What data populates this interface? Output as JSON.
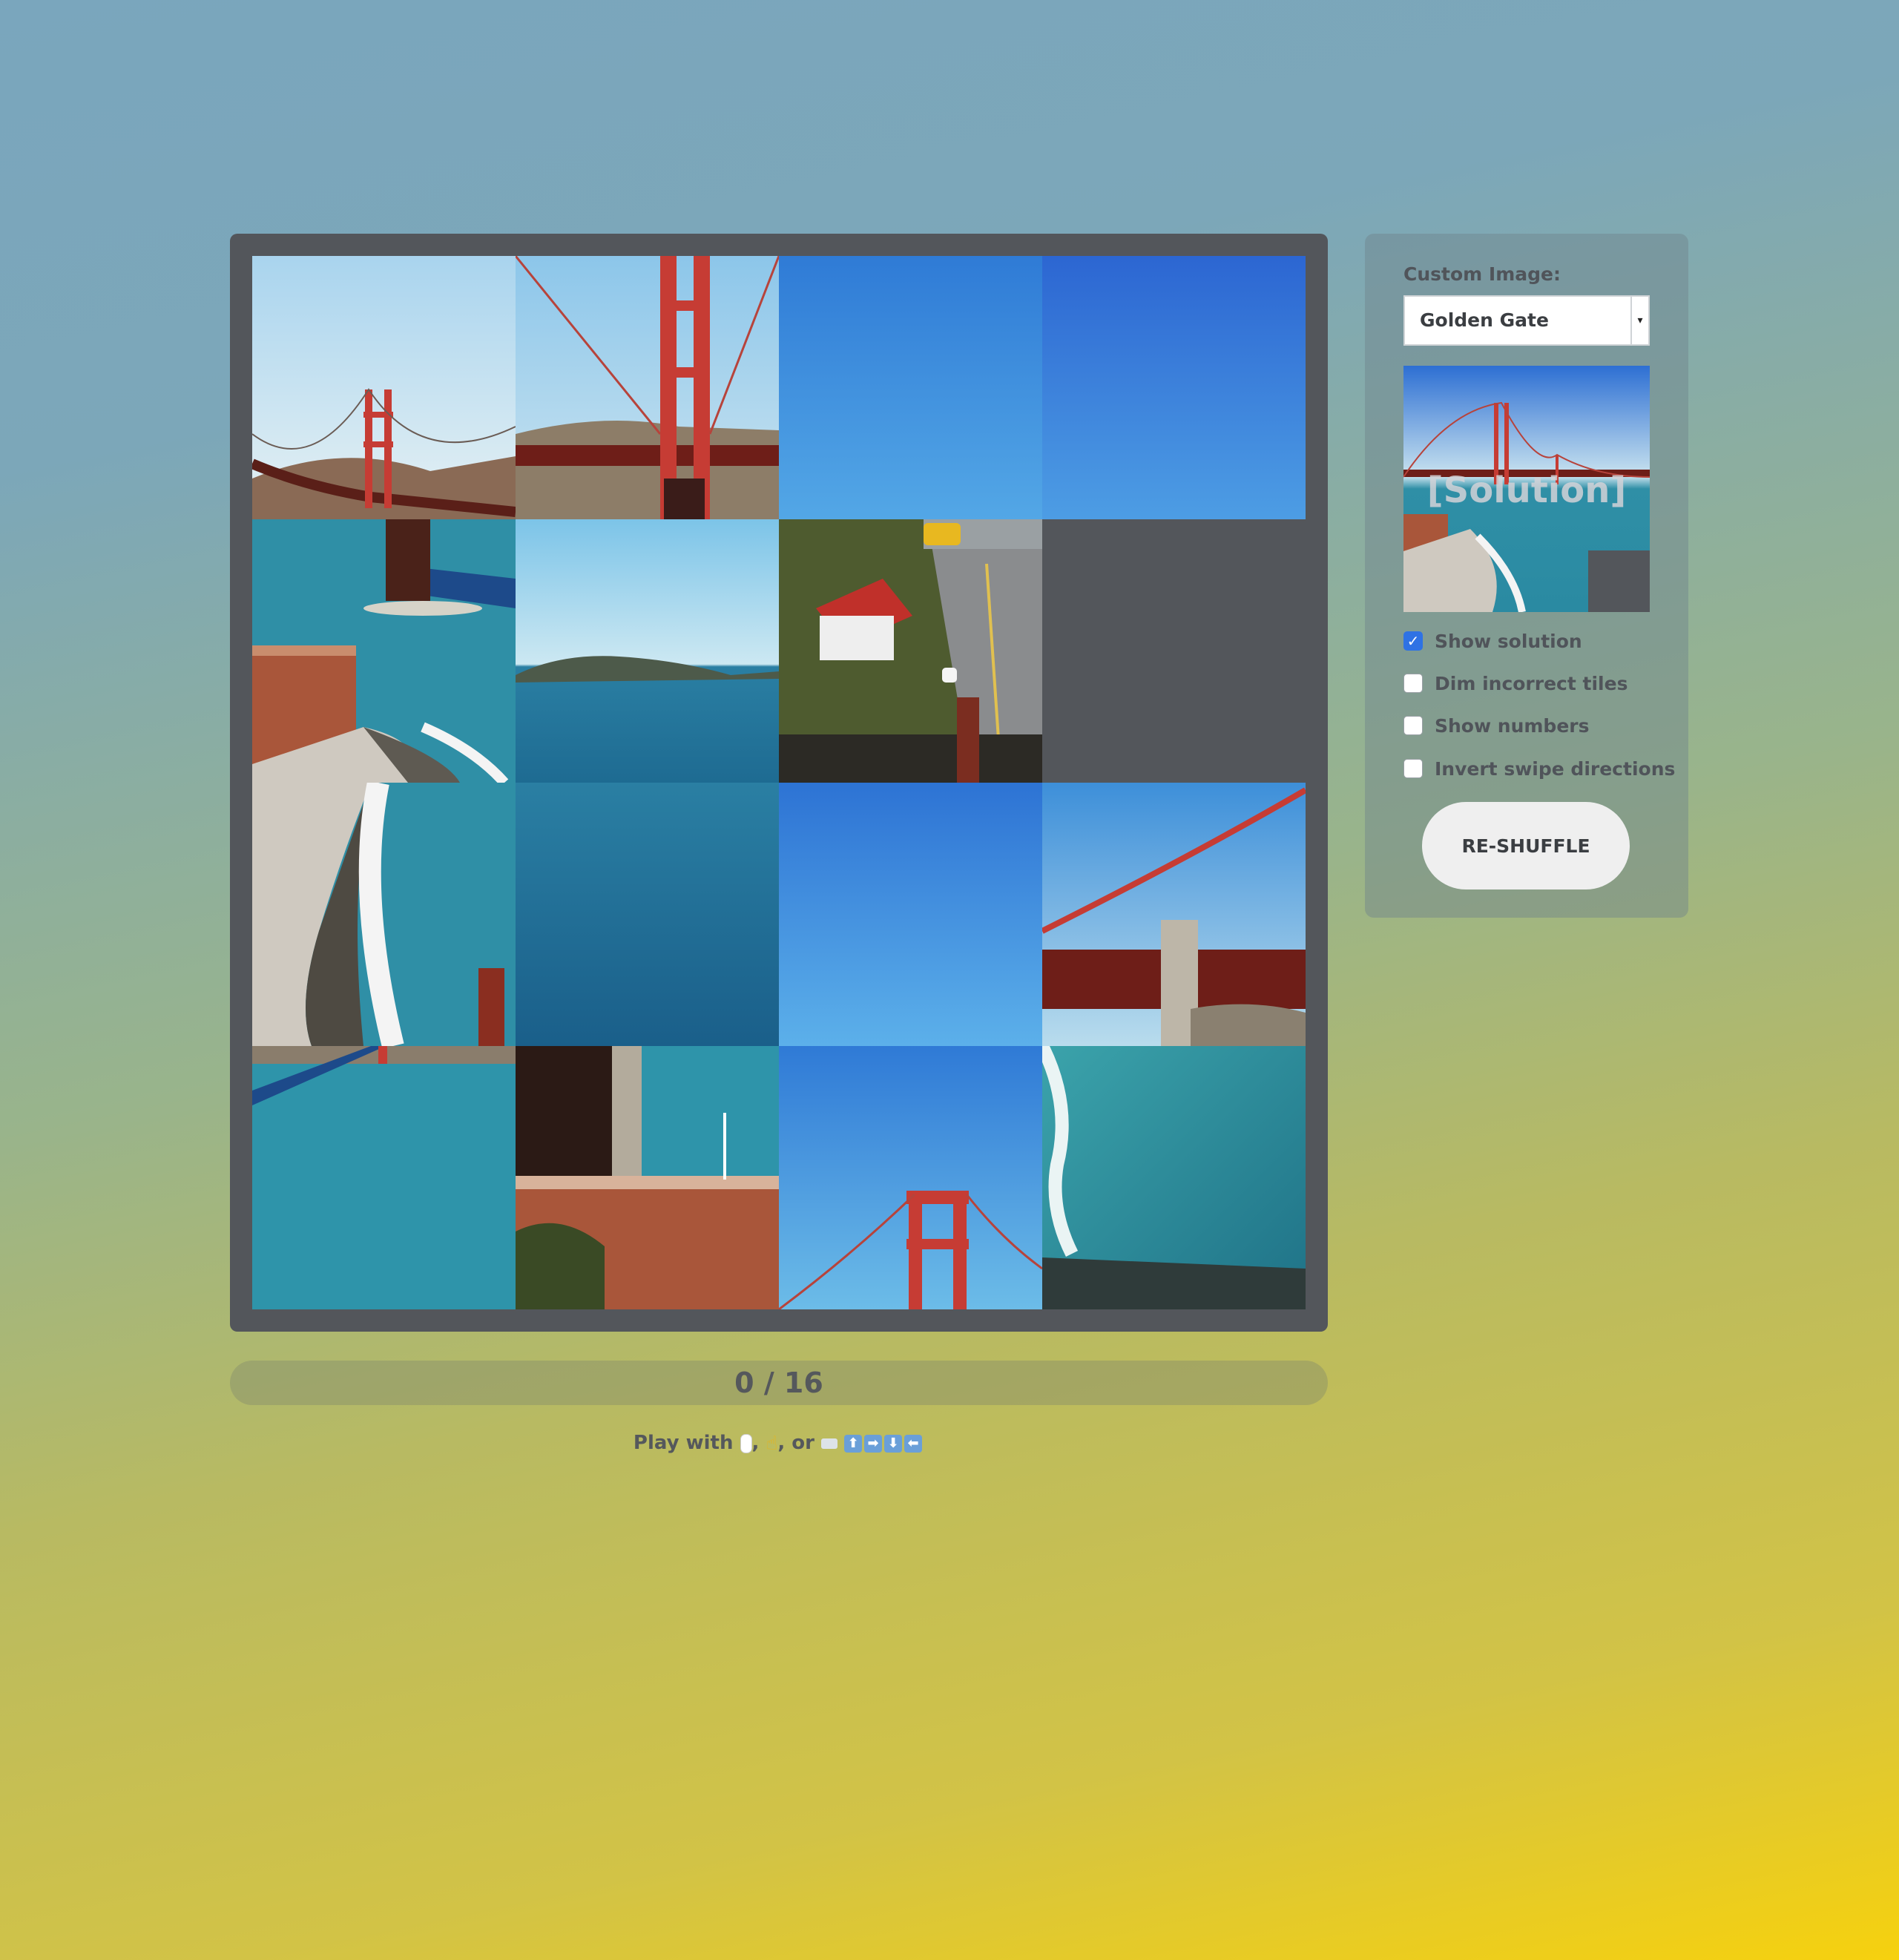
{
  "puzzle": {
    "grid_size": 4,
    "tiles": [
      {
        "piece": "sky-bridge-tower-left"
      },
      {
        "piece": "bridge-tower-close"
      },
      {
        "piece": "clear-sky"
      },
      {
        "piece": "clear-sky-dark"
      },
      {
        "piece": "fort-shore"
      },
      {
        "piece": "bay-island"
      },
      {
        "piece": "road-school-bus"
      },
      {
        "piece": "empty"
      },
      {
        "piece": "fort-shore-lower"
      },
      {
        "piece": "bay-water"
      },
      {
        "piece": "clear-sky-light"
      },
      {
        "piece": "bridge-span-right"
      },
      {
        "piece": "bay-water-wide"
      },
      {
        "piece": "fort-building"
      },
      {
        "piece": "bridge-tower-top"
      },
      {
        "piece": "surf-water"
      }
    ]
  },
  "progress": {
    "text": "0 / 16",
    "correct": 0,
    "total": 16
  },
  "instructions": {
    "prefix": "Play with",
    "sep1": ",",
    "sep2": ", or",
    "keys": [
      "⬆",
      "➡",
      "⬇",
      "⬅"
    ]
  },
  "panel": {
    "custom_image_label": "Custom Image:",
    "image_select_value": "Golden Gate",
    "preview_caption": "[Solution]",
    "options": [
      {
        "label": "Show solution",
        "checked": true
      },
      {
        "label": "Dim incorrect tiles",
        "checked": false
      },
      {
        "label": "Show numbers",
        "checked": false
      },
      {
        "label": "Invert swipe directions",
        "checked": false
      }
    ],
    "reshuffle_label": "RE-SHUFFLE"
  },
  "colors": {
    "board": "#53565b",
    "checkbox_checked": "#2f72e4",
    "bridge_red": "#c63c34",
    "sea": "#2c8fa8",
    "sky": "#3b86d9"
  }
}
